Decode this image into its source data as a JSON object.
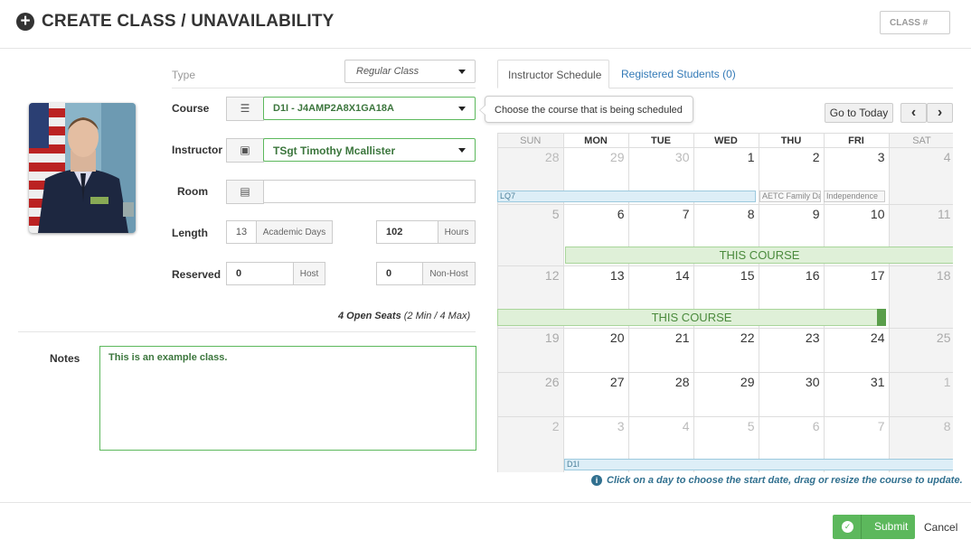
{
  "header": {
    "title": "CREATE CLASS / UNAVAILABILITY",
    "class_number_placeholder": "CLASS #"
  },
  "form": {
    "type_label": "Type",
    "type_value": "Regular Class",
    "course_label": "Course",
    "course_value": "D1I - J4AMP2A8X1GA18A",
    "instructor_label": "Instructor",
    "instructor_value": "TSgt Timothy Mcallister",
    "room_label": "Room",
    "room_value": "",
    "length_label": "Length",
    "length_days": "13",
    "length_days_unit": "Academic Days",
    "length_hours": "102",
    "length_hours_unit": "Hours",
    "reserved_label": "Reserved",
    "reserved_host": "0",
    "reserved_host_unit": "Host",
    "reserved_nonhost": "0",
    "reserved_nonhost_unit": "Non-Host",
    "open_seats": "4 Open Seats",
    "seats_range": "(2 Min / 4 Max)",
    "notes_label": "Notes",
    "notes_value": "This is an example class."
  },
  "tooltip": "Choose the course that is being scheduled",
  "tabs": {
    "instructor_schedule": "Instructor Schedule",
    "registered_students": "Registered Students (0)"
  },
  "calendar": {
    "go_today": "Go to Today",
    "prev": "‹",
    "next": "›",
    "days": [
      "SUN",
      "MON",
      "TUE",
      "WED",
      "THU",
      "FRI",
      "SAT"
    ],
    "weeks": [
      [
        "28",
        "29",
        "30",
        "1",
        "2",
        "3",
        "4"
      ],
      [
        "5",
        "6",
        "7",
        "8",
        "9",
        "10",
        "11"
      ],
      [
        "12",
        "13",
        "14",
        "15",
        "16",
        "17",
        "18"
      ],
      [
        "19",
        "20",
        "21",
        "22",
        "23",
        "24",
        "25"
      ],
      [
        "26",
        "27",
        "28",
        "29",
        "30",
        "31",
        "1"
      ],
      [
        "2",
        "3",
        "4",
        "5",
        "6",
        "7",
        "8"
      ]
    ],
    "events": {
      "lq7": "LQ7",
      "aetc": "AETC Family Da",
      "independence": "Independence",
      "this_course_1": "THIS COURSE",
      "this_course_2": "THIS COURSE",
      "d1i": "D1I"
    },
    "help_text": "Click on a day to choose the start date, drag or resize the course to update."
  },
  "footer": {
    "submit": "Submit",
    "cancel": "Cancel"
  },
  "colors": {
    "accent_green": "#5cb85c",
    "link_blue": "#337ab7"
  }
}
